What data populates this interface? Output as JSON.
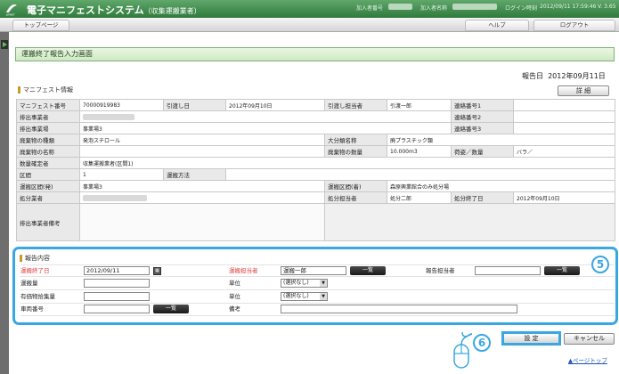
{
  "header": {
    "app_title": "電子マニフェストシステム",
    "app_subtitle": "（収集運搬業者）",
    "subscriber_label": "加入者番号",
    "subscriber_name_label": "加入者名称",
    "login_time_label": "ログイン時刻",
    "login_time": "2012/09/11 17:59:46",
    "version": "V. 3.65"
  },
  "menu": {
    "top_page": "トップページ",
    "help": "ヘルプ",
    "logout": "ログアウト"
  },
  "page": {
    "title": "運搬終了報告入力画面",
    "report_date_label": "報告日",
    "report_date": "2012年09月11日"
  },
  "manifest": {
    "section_title": "マニフェスト情報",
    "detail_button": "詳 細",
    "fields": {
      "manifest_no_label": "マニフェスト番号",
      "manifest_no": "70000919983",
      "handover_date_label": "引渡し日",
      "handover_date": "2012年09月10日",
      "handover_person_label": "引渡し担当者",
      "handover_person": "引渡一郎",
      "contact1_label": "連絡番号1",
      "emitter_label": "排出事業者",
      "contact2_label": "連絡番号2",
      "emitter_site_label": "排出事業場",
      "emitter_site": "事業場3",
      "contact3_label": "連絡番号3",
      "waste_type_label": "廃棄物の種類",
      "waste_type": "発泡スチロール",
      "major_class_label": "大分類名称",
      "major_class": "廃プラスチック類",
      "waste_name_label": "廃棄物の名称",
      "waste_qty_label": "廃棄物の数量",
      "waste_qty": "10.000m3",
      "packing_label": "荷姿／数量",
      "packing": "バラ／",
      "qty_confirmer_label": "数量確定者",
      "qty_confirmer": "収集運搬業者(区間1)",
      "section_label": "区間",
      "section": "1",
      "transport_method_label": "運搬方法",
      "transport_from_label": "運搬区間(発)",
      "transport_from": "事業場3",
      "transport_to_label": "運搬区間(着)",
      "transport_to": "森原興業館合のみ処分場",
      "disposer_label": "処分業者",
      "disposer_person_label": "処分担当者",
      "disposer_person": "処分二郎",
      "disposal_end_label": "処分終了日",
      "disposal_end": "2012年09月10日",
      "emitter_note_label": "排出事業者備考"
    }
  },
  "report": {
    "section_title": "報告内容",
    "end_date_label": "運搬終了日",
    "end_date_value": "2012/09/11",
    "person_label": "運搬担当者",
    "person_value": "運搬一郎",
    "reporter_label": "報告担当者",
    "list_button": "一覧",
    "quantity_label": "運搬量",
    "unit_label": "単位",
    "unit_value": "(選択なし)",
    "valuables_label": "有価物拾集量",
    "vehicle_label": "車両番号",
    "remarks_label": "備考",
    "calendar_icon": "calendar-icon"
  },
  "annotations": {
    "badge5": "5",
    "badge6": "6"
  },
  "actions": {
    "set": "設 定",
    "cancel": "キャンセル",
    "page_top": "▲ページトップ"
  },
  "colors": {
    "header_green": "#3d8a48",
    "highlight_blue": "#3aa8e0",
    "required_red": "#e23c3c"
  }
}
